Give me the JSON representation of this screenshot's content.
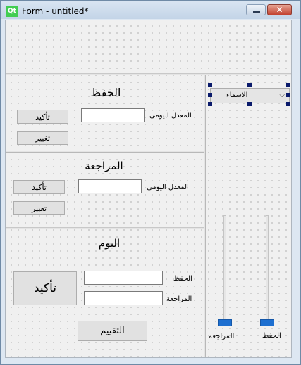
{
  "window": {
    "logo_text": "Qt",
    "title": "Form - untitled*",
    "close_glyph": "✕"
  },
  "memorize": {
    "title": "الحفظ",
    "confirm_label": "تأكيد",
    "change_label": "تغيير",
    "daily_rate_label": "المعدل اليومى",
    "daily_rate_value": ""
  },
  "review": {
    "title": "المراجعة",
    "confirm_label": "تأكيد",
    "change_label": "تغيير",
    "daily_rate_label": "المعدل اليومى",
    "daily_rate_value": ""
  },
  "today": {
    "title": "اليوم",
    "confirm_label": "تأكيد",
    "memorize_label": "الحفظ",
    "review_label": "المراجعة",
    "memorize_value": "",
    "review_value": "",
    "evaluate_label": "التقييم"
  },
  "side": {
    "names_combo": "الاسماء",
    "combo_arrow": "⌵",
    "review_slider_label": "المراجعة",
    "memorize_slider_label": "الحفظ",
    "review_slider_value": 0,
    "memorize_slider_value": 0
  },
  "colors": {
    "slider_thumb": "#1d6fd0",
    "selection_handle": "#0a1a6b"
  },
  "icons": {
    "minimize": "minimize-icon",
    "close": "close-icon",
    "app": "qt-logo-icon"
  }
}
